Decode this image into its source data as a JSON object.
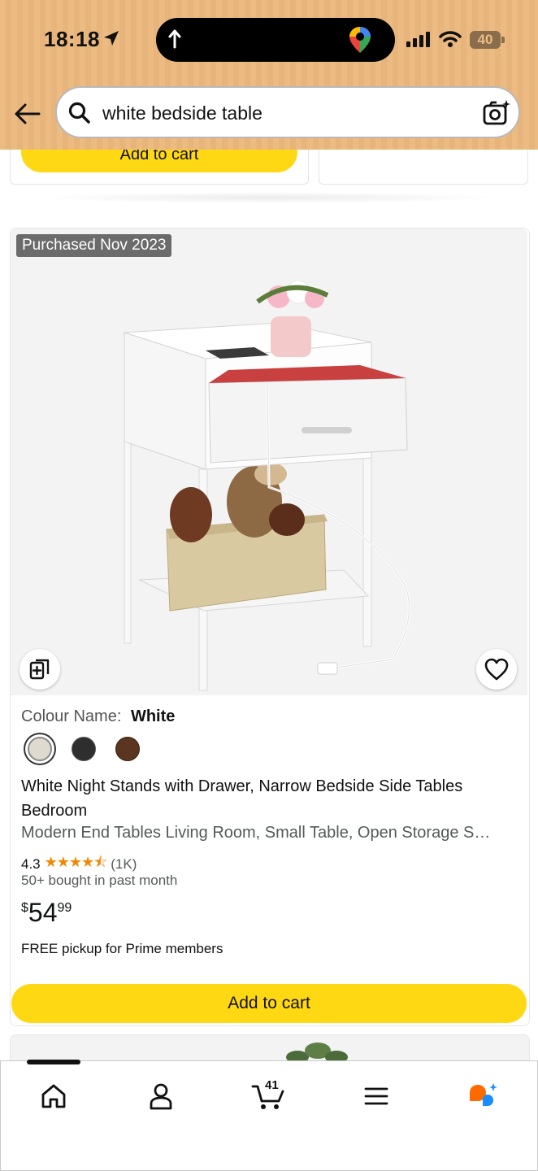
{
  "status_bar": {
    "time": "18:18",
    "battery": "40"
  },
  "search": {
    "query": "white bedside table"
  },
  "previous_card": {
    "add_to_cart_label": "Add to cart"
  },
  "product": {
    "badge": "Purchased Nov 2023",
    "colour_label": "Colour Name:",
    "colour_value": "White",
    "swatches": [
      "#dedad0",
      "#2e2e2e",
      "#5a3520"
    ],
    "title": "White Night Stands with Drawer, Narrow Bedside Side Tables Bedroom",
    "subtitle": "Modern End Tables Living Room, Small Table, Open Storage S…",
    "rating": "4.3",
    "rating_value": 4.3,
    "review_count": "(1K)",
    "bought": "50+ bought in past month",
    "price_currency": "$",
    "price_whole": "54",
    "price_fraction": "99",
    "pickup": "FREE pickup for Prime members",
    "add_to_cart_label": "Add to cart"
  },
  "tab_bar": {
    "cart_count": "41",
    "tabs": [
      "home-icon",
      "account-icon",
      "cart-icon",
      "menu-icon",
      "rufus-icon"
    ]
  },
  "colors": {
    "accent_yellow": "#ffd814",
    "star_orange": "#f08804",
    "header_bg": "#ecbb82"
  }
}
